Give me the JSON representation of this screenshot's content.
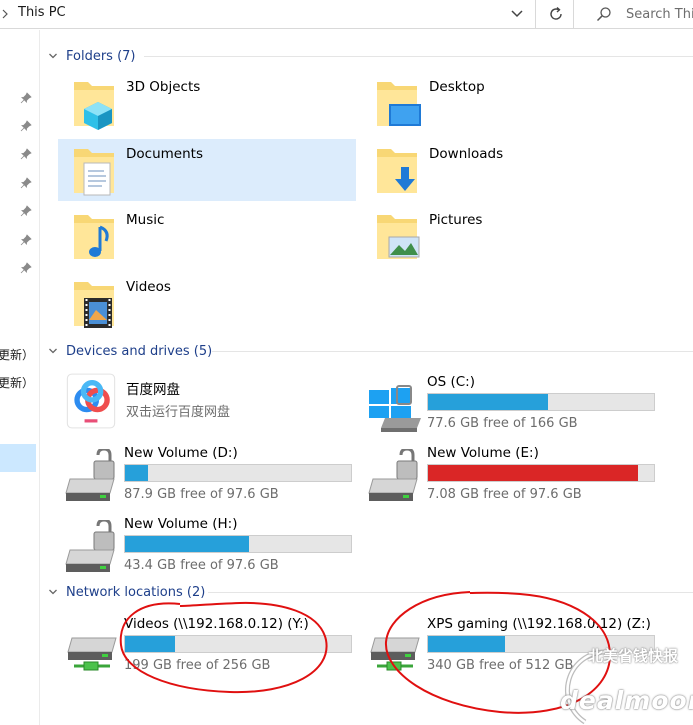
{
  "address": {
    "path": "This PC",
    "search_placeholder": "Search Thi"
  },
  "navpane": {
    "pinned_count": 7,
    "partial_labels": [
      "更新）",
      "更新）"
    ]
  },
  "sections": {
    "folders": {
      "label": "Folders (7)"
    },
    "drives": {
      "label": "Devices and drives (5)"
    },
    "network": {
      "label": "Network locations (2)"
    }
  },
  "folders": [
    {
      "name": "3D Objects",
      "icon": "3d-objects-folder-icon"
    },
    {
      "name": "Desktop",
      "icon": "desktop-folder-icon"
    },
    {
      "name": "Documents",
      "icon": "documents-folder-icon",
      "selected": true
    },
    {
      "name": "Downloads",
      "icon": "downloads-folder-icon"
    },
    {
      "name": "Music",
      "icon": "music-folder-icon"
    },
    {
      "name": "Pictures",
      "icon": "pictures-folder-icon"
    },
    {
      "name": "Videos",
      "icon": "videos-folder-icon"
    }
  ],
  "app_tile": {
    "name": "百度网盘",
    "sub": "双击运行百度网盘",
    "icon": "baidu-netdisk-icon"
  },
  "drives": [
    {
      "name": "OS (C:)",
      "free": "77.6 GB free of 166 GB",
      "used_fraction": 0.53,
      "color": "#26a0da",
      "icon": "windows-drive-icon"
    },
    {
      "name": "New Volume (D:)",
      "free": "87.9 GB free of 97.6 GB",
      "used_fraction": 0.1,
      "color": "#26a0da",
      "icon": "locked-drive-icon"
    },
    {
      "name": "New Volume (E:)",
      "free": "7.08 GB free of 97.6 GB",
      "used_fraction": 0.93,
      "color": "#da2626",
      "icon": "locked-drive-icon"
    },
    {
      "name": "New Volume (H:)",
      "free": "43.4 GB free of 97.6 GB",
      "used_fraction": 0.55,
      "color": "#26a0da",
      "icon": "locked-drive-icon"
    }
  ],
  "network_drives": [
    {
      "name": "Videos (\\\\192.168.0.12) (Y:)",
      "free": "199 GB free of 256 GB",
      "used_fraction": 0.22,
      "color": "#26a0da",
      "icon": "network-drive-icon"
    },
    {
      "name": "XPS gaming (\\\\192.168.0.12) (Z:)",
      "free": "340 GB free of 512 GB",
      "used_fraction": 0.34,
      "color": "#26a0da",
      "icon": "network-drive-icon"
    }
  ],
  "watermark": {
    "line1": "北美省钱快报",
    "line2": "dealmoon"
  },
  "colors": {
    "accent": "#26a0da",
    "warning": "#da2626",
    "selection": "#dcecfc",
    "header_text": "#1e3f8a",
    "annotation": "#e01010"
  }
}
